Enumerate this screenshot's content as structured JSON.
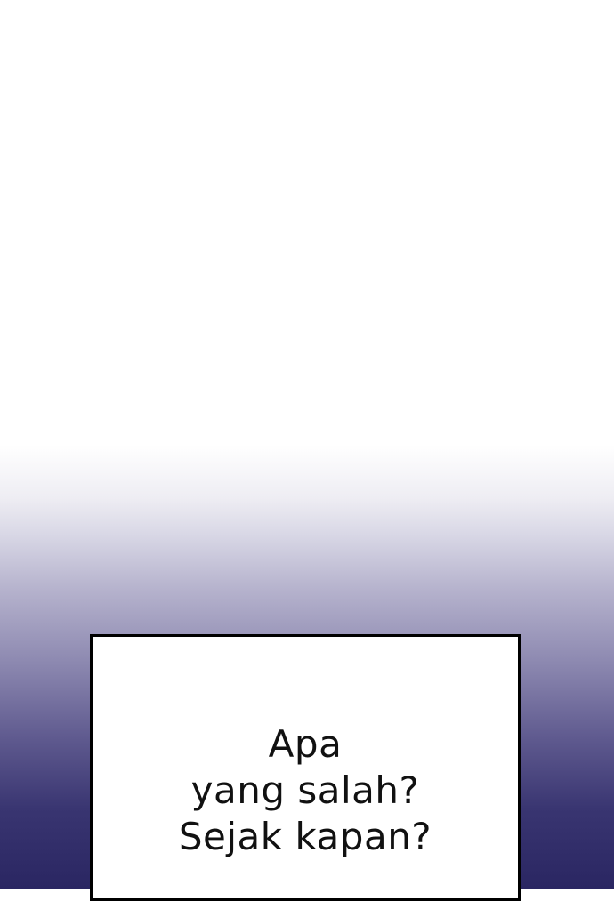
{
  "caption": {
    "lines": [
      "Apa",
      "yang salah?",
      "Sejak kapan?"
    ]
  },
  "colors": {
    "background_top": "#ffffff",
    "background_bottom": "#2a2662",
    "box_fill": "#ffffff",
    "box_border": "#000000",
    "text": "#111111"
  }
}
